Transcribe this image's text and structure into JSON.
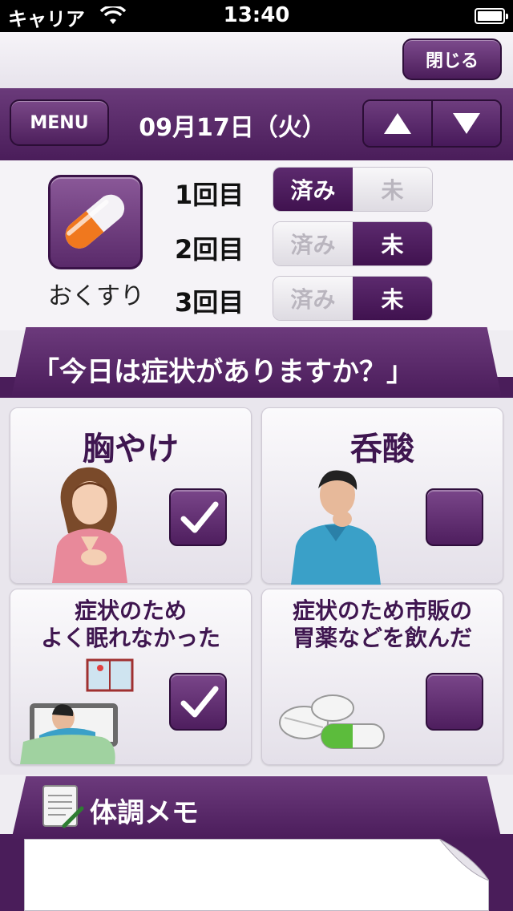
{
  "status_bar": {
    "carrier": "キャリア",
    "time": "13:40"
  },
  "toolbar": {
    "close_label": "閉じる"
  },
  "date_header": {
    "menu_label": "MENU",
    "date": "09月17日（火）"
  },
  "medicine": {
    "label": "おくすり",
    "done_label": "済み",
    "not_done_label": "未",
    "doses": [
      {
        "label": "1回目",
        "state": "done"
      },
      {
        "label": "2回目",
        "state": "not_done"
      },
      {
        "label": "3回目",
        "state": "not_done"
      }
    ]
  },
  "question": "「今日は症状がありますか？」",
  "symptoms": [
    {
      "line1": "胸やけ",
      "line2": "",
      "checked": true
    },
    {
      "line1": "呑酸",
      "line2": "",
      "checked": false
    },
    {
      "line1": "症状のため",
      "line2": "よく眠れなかった",
      "checked": true
    },
    {
      "line1": "症状のため市販の",
      "line2": "胃薬などを飲んだ",
      "checked": false
    }
  ],
  "memo": {
    "title": "体調メモ"
  },
  "colors": {
    "accent": "#4a1d5a",
    "pill_orange": "#f0781e"
  }
}
